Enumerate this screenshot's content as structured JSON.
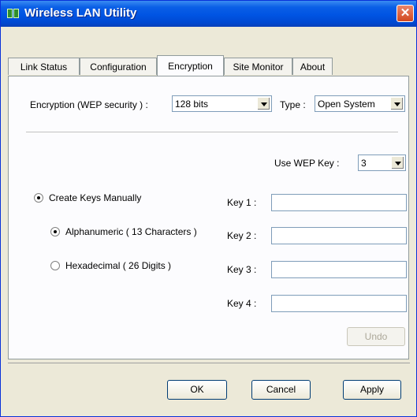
{
  "window": {
    "title": "Wireless LAN Utility"
  },
  "tabs": [
    {
      "label": "Link Status"
    },
    {
      "label": "Configuration"
    },
    {
      "label": "Encryption"
    },
    {
      "label": "Site Monitor"
    },
    {
      "label": "About"
    }
  ],
  "encryption": {
    "wep_label": "Encryption (WEP security ) :",
    "wep_value": "128 bits",
    "type_label": "Type :",
    "type_value": "Open System",
    "use_key_label": "Use WEP Key :",
    "use_key_value": "3",
    "create_keys_label": "Create Keys Manually",
    "alnum_label": "Alphanumeric ( 13 Characters )",
    "hex_label": "Hexadecimal ( 26 Digits )",
    "keys": [
      {
        "label": "Key 1 :",
        "value": ""
      },
      {
        "label": "Key 2 :",
        "value": ""
      },
      {
        "label": "Key 3 :",
        "value": ""
      },
      {
        "label": "Key 4 :",
        "value": ""
      }
    ],
    "undo_label": "Undo"
  },
  "buttons": {
    "ok": "OK",
    "cancel": "Cancel",
    "apply": "Apply"
  },
  "colors": {
    "title_bar": "#0054e3",
    "face": "#ece9d8",
    "close": "#d2481f"
  }
}
